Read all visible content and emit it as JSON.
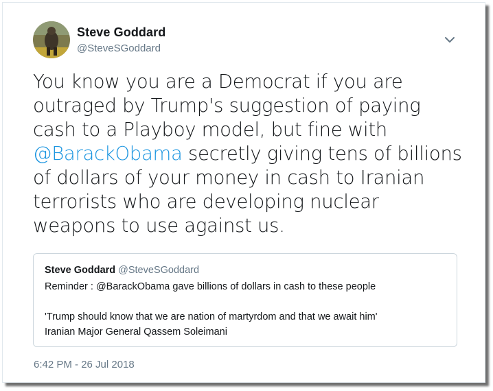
{
  "author": {
    "name": "Steve Goddard",
    "handle": "@SteveSGoddard",
    "avatar_icon": "profile-photo-avatar"
  },
  "menu_icon": "chevron-down-icon",
  "tweet": {
    "text_before_mention": "You know you are a Democrat if you are outraged by Trump's suggestion of paying cash to a Playboy model, but fine with ",
    "mention": "@BarackObama",
    "text_after_mention": " secretly giving tens of billions of dollars of your money in cash to Iranian terrorists who are developing nuclear weapons to use against us."
  },
  "quoted_tweet": {
    "name": "Steve Goddard",
    "handle": "@SteveSGoddard",
    "line1": "Reminder :  @BarackObama gave billions of dollars in cash to these people",
    "line2": "'Trump should know that we are nation of martyrdom and that we await him'",
    "line3": "Iranian Major General Qassem Soleimani"
  },
  "timestamp": "6:42 PM - 26 Jul 2018",
  "colors": {
    "link": "#1b95e0",
    "text": "#14171a",
    "secondary": "#657786",
    "border": "#ccd6dd"
  }
}
